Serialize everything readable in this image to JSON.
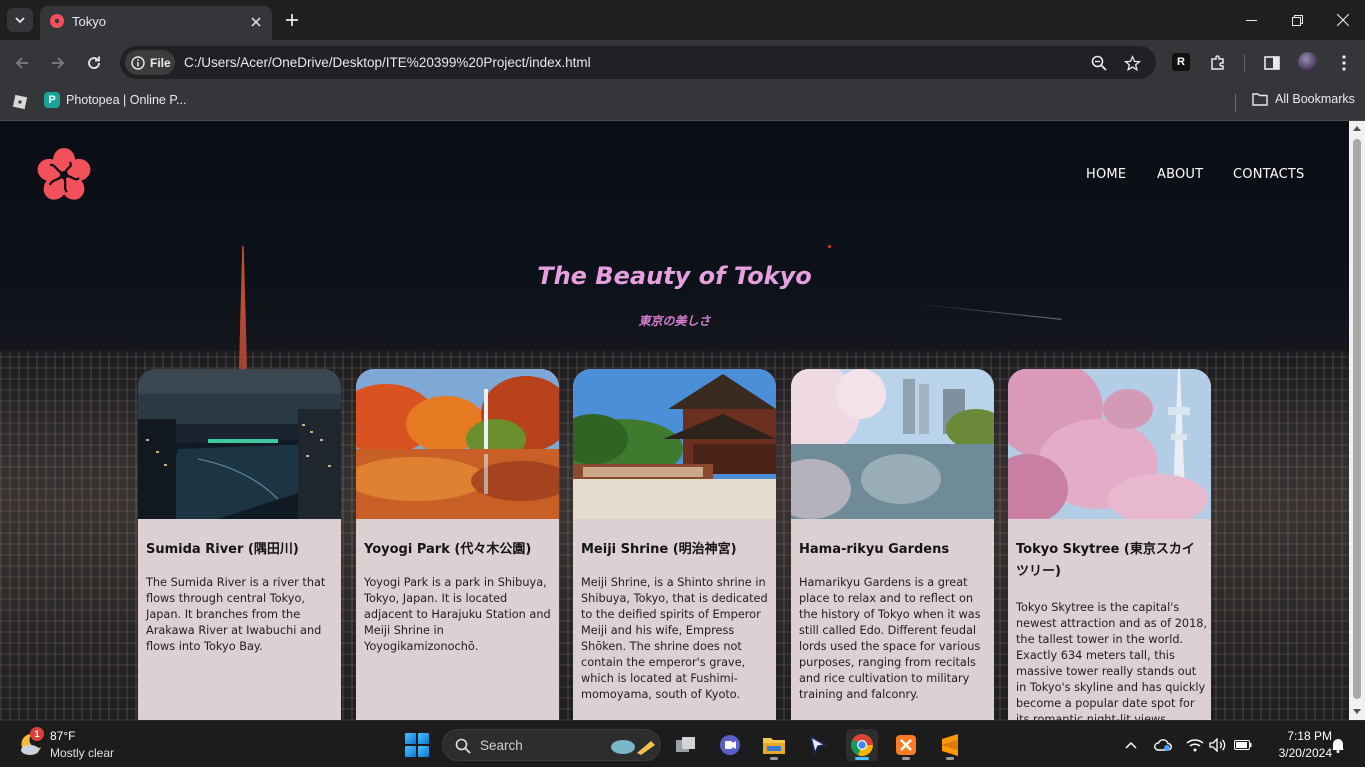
{
  "browser": {
    "tab_title": "Tokyo",
    "url_chip": "File",
    "url": "C:/Users/Acer/OneDrive/Desktop/ITE%20399%20Project/index.html",
    "bookmarks": [
      {
        "label": "Photopea | Online P..."
      }
    ],
    "all_bookmarks": "All Bookmarks",
    "extension_letter": "R"
  },
  "site": {
    "nav": [
      "HOME",
      "ABOUT",
      "CONTACTS"
    ],
    "hero_title": "The Beauty of Tokyo",
    "hero_subtitle": "東京の美しさ",
    "cards": [
      {
        "title": "Sumida River (隅田川)",
        "text": "The Sumida River is a river that flows through central Tokyo, Japan. It branches from the Arakawa River at Iwabuchi and flows into Tokyo Bay."
      },
      {
        "title": "Yoyogi Park (代々木公園)",
        "text": "Yoyogi Park is a park in Shibuya, Tokyo, Japan. It is located adjacent to Harajuku Station and Meiji Shrine in Yoyogikamizonochō."
      },
      {
        "title": "Meiji Shrine (明治神宮)",
        "text": "Meiji Shrine, is a Shinto shrine in Shibuya, Tokyo, that is dedicated to the deified spirits of Emperor Meiji and his wife, Empress Shōken. The shrine does not contain the emperor's grave, which is located at Fushimi-momoyama, south of Kyoto."
      },
      {
        "title": "Hama-rikyu Gardens",
        "text": "Hamarikyu Gardens is a great place to relax and to reflect on the history of Tokyo when it was still called Edo. Different feudal lords used the space for various purposes, ranging from recitals and rice cultivation to military training and falconry."
      },
      {
        "title": "Tokyo Skytree (東京スカイツリー)",
        "text": "Tokyo Skytree is the capital's newest attraction and as of 2018, the tallest tower in the world. Exactly 634 meters tall, this massive tower really stands out in Tokyo's skyline and has quickly become a popular date spot for its romantic night-lit views."
      }
    ]
  },
  "taskbar": {
    "weather_badge": "1",
    "temperature": "87°F",
    "condition": "Mostly clear",
    "search_label": "Search",
    "time": "7:18 PM",
    "date": "3/20/2024"
  },
  "colors": {
    "hero_title": "#e6a0e0",
    "hero_subtitle": "#d77fd3",
    "card_body": "#dcd0d3",
    "logo": "#f2505a"
  },
  "icons": [
    "tab-search-icon",
    "globe-favicon-icon",
    "close-icon",
    "plus-icon",
    "minimize-icon",
    "restore-icon",
    "back-arrow-icon",
    "forward-arrow-icon",
    "reload-icon",
    "info-icon",
    "zoom-icon",
    "star-icon",
    "puzzle-icon",
    "sidepanel-icon",
    "more-vert-icon",
    "folder-icon",
    "sakura-logo-icon",
    "windows-start-icon",
    "search-icon",
    "wifi-icon",
    "volume-icon",
    "battery-icon",
    "bell-icon"
  ]
}
